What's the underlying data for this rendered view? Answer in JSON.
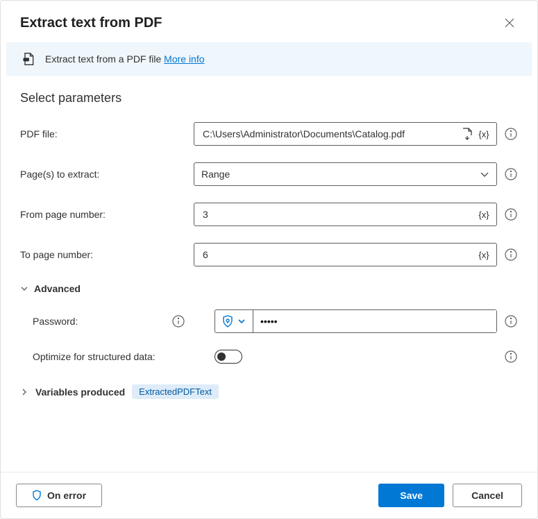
{
  "header": {
    "title": "Extract text from PDF"
  },
  "banner": {
    "text": "Extract text from a PDF file ",
    "link": "More info"
  },
  "section": {
    "title": "Select parameters"
  },
  "fields": {
    "pdf_label": "PDF file:",
    "pdf_value": "C:\\Users\\Administrator\\Documents\\Catalog.pdf",
    "pages_label": "Page(s) to extract:",
    "pages_value": "Range",
    "from_label": "From page number:",
    "from_value": "3",
    "to_label": "To page number:",
    "to_value": "6"
  },
  "advanced": {
    "label": "Advanced",
    "password_label": "Password:",
    "password_value": "•••••",
    "optimize_label": "Optimize for structured data:"
  },
  "vars": {
    "label": "Variables produced",
    "value": "ExtractedPDFText"
  },
  "footer": {
    "on_error": "On error",
    "save": "Save",
    "cancel": "Cancel"
  }
}
